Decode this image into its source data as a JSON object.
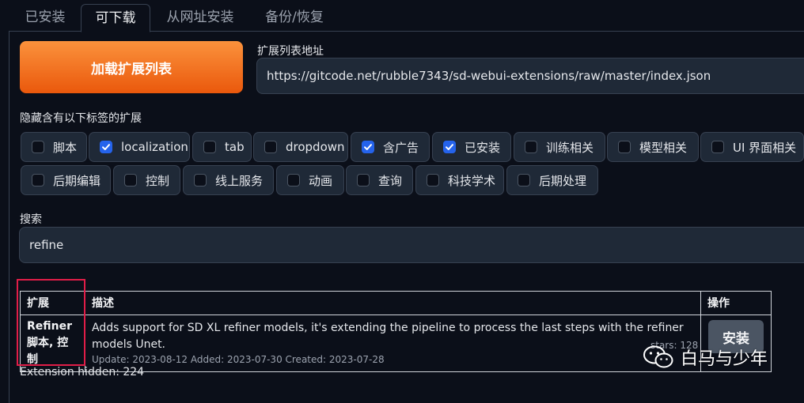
{
  "tabs": [
    "已安装",
    "可下载",
    "从网址安装",
    "备份/恢复"
  ],
  "load_button": "加载扩展列表",
  "url_field": {
    "label": "扩展列表地址",
    "value": "https://gitcode.net/rubble7343/sd-webui-extensions/raw/master/index.json"
  },
  "hide_tags": {
    "label": "隐藏含有以下标签的扩展",
    "tags": [
      {
        "label": "脚本",
        "checked": false
      },
      {
        "label": "localization",
        "checked": true
      },
      {
        "label": "tab",
        "checked": false
      },
      {
        "label": "dropdown",
        "checked": false
      },
      {
        "label": "含广告",
        "checked": true
      },
      {
        "label": "已安装",
        "checked": true
      },
      {
        "label": "训练相关",
        "checked": false
      },
      {
        "label": "模型相关",
        "checked": false
      },
      {
        "label": "UI 界面相关",
        "checked": false
      },
      {
        "label": "后期编辑",
        "checked": false
      },
      {
        "label": "控制",
        "checked": false
      },
      {
        "label": "线上服务",
        "checked": false
      },
      {
        "label": "动画",
        "checked": false
      },
      {
        "label": "查询",
        "checked": false
      },
      {
        "label": "科技学术",
        "checked": false
      },
      {
        "label": "后期处理",
        "checked": false
      }
    ]
  },
  "search": {
    "label": "搜索",
    "value": "refine"
  },
  "table": {
    "headers": [
      "扩展",
      "描述",
      "操作"
    ],
    "row": {
      "name": "Refiner",
      "tags": "脚本, 控制",
      "description": "Adds support for SD XL refiner models, it's extending the pipeline to process the last steps with the refiner models Unet.",
      "meta": "Update: 2023-08-12 Added: 2023-07-30 Created: 2023-07-28",
      "stars": "stars: 128",
      "action": "安装"
    }
  },
  "hidden_count": "Extension hidden: 224",
  "watermark": "白马与少年",
  "colors": {
    "accent": "#f97316",
    "checkbox": "#2563eb",
    "highlight_box": "#e11d48"
  }
}
